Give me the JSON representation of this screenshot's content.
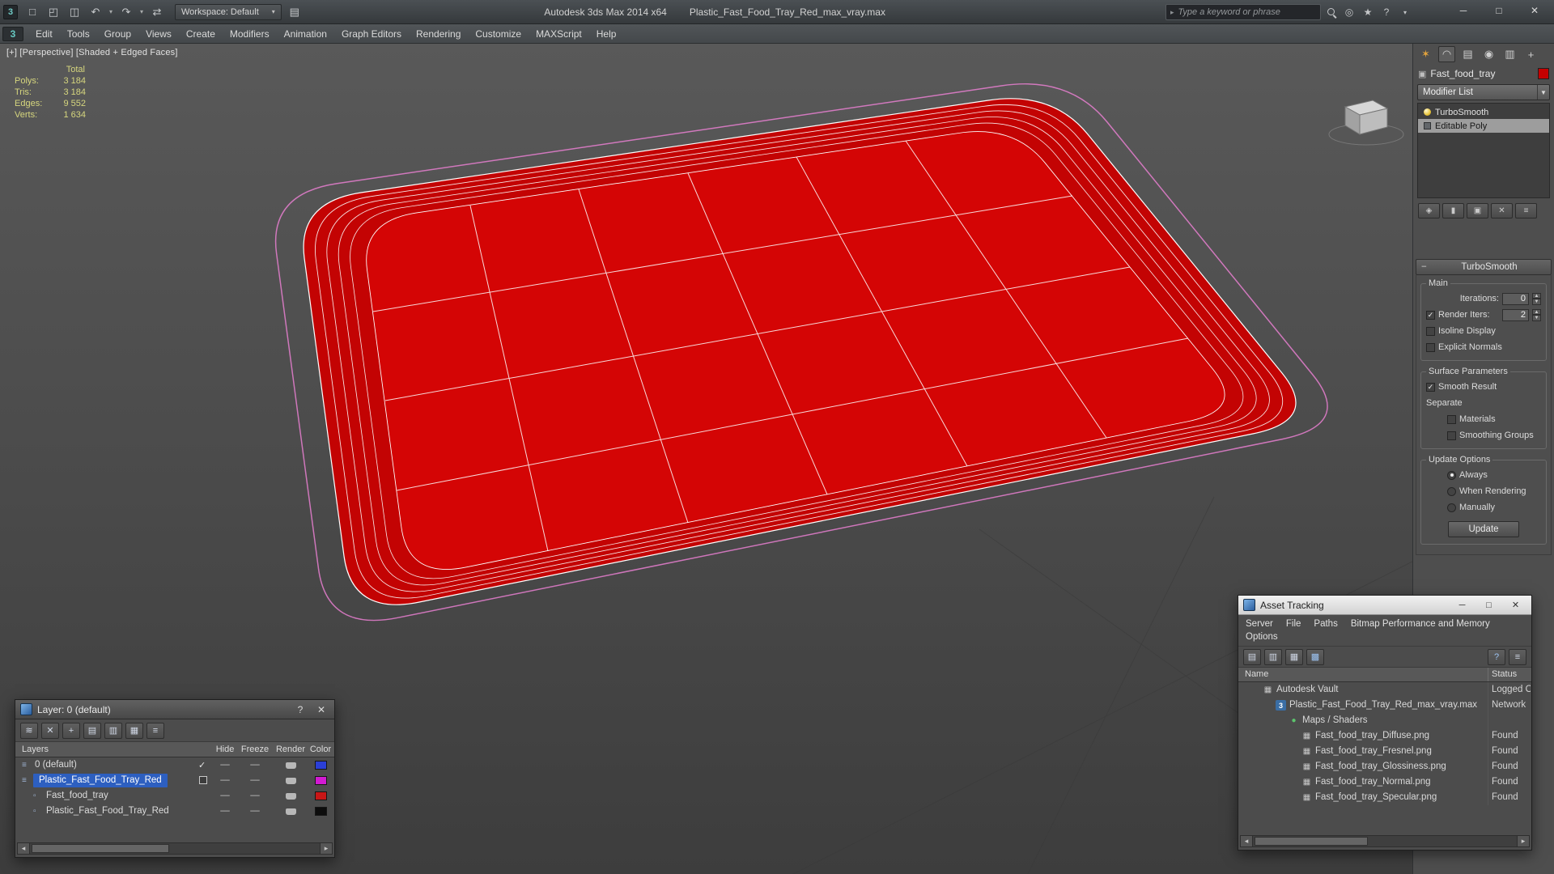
{
  "window": {
    "app_title": "Autodesk 3ds Max 2014 x64",
    "document_title": "Plastic_Fast_Food_Tray_Red_max_vray.max",
    "workspace_label": "Workspace: Default",
    "search_placeholder": "Type a keyword or phrase"
  },
  "menubar": {
    "items": [
      "Edit",
      "Tools",
      "Group",
      "Views",
      "Create",
      "Modifiers",
      "Animation",
      "Graph Editors",
      "Rendering",
      "Customize",
      "MAXScript",
      "Help"
    ]
  },
  "viewport": {
    "label": "[+] [Perspective] [Shaded + Edged Faces]",
    "stats": {
      "title": "Total",
      "rows": [
        {
          "label": "Polys:",
          "value": "3 184"
        },
        {
          "label": "Tris:",
          "value": "3 184"
        },
        {
          "label": "Edges:",
          "value": "9 552"
        },
        {
          "label": "Verts:",
          "value": "1 634"
        }
      ]
    }
  },
  "command_panel": {
    "object_name": "Fast_food_tray",
    "modifier_list_label": "Modifier List",
    "stack": [
      {
        "label": "TurboSmooth"
      },
      {
        "label": "Editable Poly"
      }
    ],
    "rollout": {
      "title": "TurboSmooth",
      "main_label": "Main",
      "iterations_label": "Iterations:",
      "iterations_value": "0",
      "render_iters_label": "Render Iters:",
      "render_iters_value": "2",
      "isoline_label": "Isoline Display",
      "explicit_label": "Explicit Normals",
      "surface_label": "Surface Parameters",
      "smooth_result_label": "Smooth Result",
      "separate_label": "Separate",
      "materials_label": "Materials",
      "smoothing_label": "Smoothing Groups",
      "update_options_label": "Update Options",
      "always_label": "Always",
      "when_rendering_label": "When Rendering",
      "manually_label": "Manually",
      "update_button": "Update"
    }
  },
  "layer_dialog": {
    "title": "Layer: 0 (default)",
    "columns": [
      "Layers",
      "Hide",
      "Freeze",
      "Render",
      "Color"
    ],
    "rows": [
      {
        "name": "0 (default)",
        "hide": "—",
        "freeze": "—",
        "color": "#2b3fd6"
      },
      {
        "name": "Plastic_Fast_Food_Tray_Red",
        "hide": "—",
        "freeze": "—",
        "color": "#d21ad2"
      },
      {
        "name": "Fast_food_tray",
        "hide": "—",
        "freeze": "—",
        "color": "#c81616"
      },
      {
        "name": "Plastic_Fast_Food_Tray_Red",
        "hide": "—",
        "freeze": "—",
        "color": "#0d0d0d"
      }
    ]
  },
  "asset_tracking": {
    "title": "Asset Tracking",
    "menu": [
      "Server",
      "File",
      "Paths",
      "Bitmap Performance and Memory",
      "Options"
    ],
    "name_column": "Name",
    "status_column": "Status",
    "rows": [
      {
        "name": "Autodesk Vault",
        "status": "Logged O"
      },
      {
        "name": "Plastic_Fast_Food_Tray_Red_max_vray.max",
        "status": "Network"
      },
      {
        "name": "Maps / Shaders",
        "status": ""
      },
      {
        "name": "Fast_food_tray_Diffuse.png",
        "status": "Found"
      },
      {
        "name": "Fast_food_tray_Fresnel.png",
        "status": "Found"
      },
      {
        "name": "Fast_food_tray_Glossiness.png",
        "status": "Found"
      },
      {
        "name": "Fast_food_tray_Normal.png",
        "status": "Found"
      },
      {
        "name": "Fast_food_tray_Specular.png",
        "status": "Found"
      }
    ]
  },
  "colors": {
    "tray_rim": "#c30303",
    "tray_floor": "#d40505",
    "wire": "#ffffff",
    "cage_pink": "#e87fd0",
    "selection_blue": "#2d5fc0",
    "object_color": "#c40000"
  }
}
